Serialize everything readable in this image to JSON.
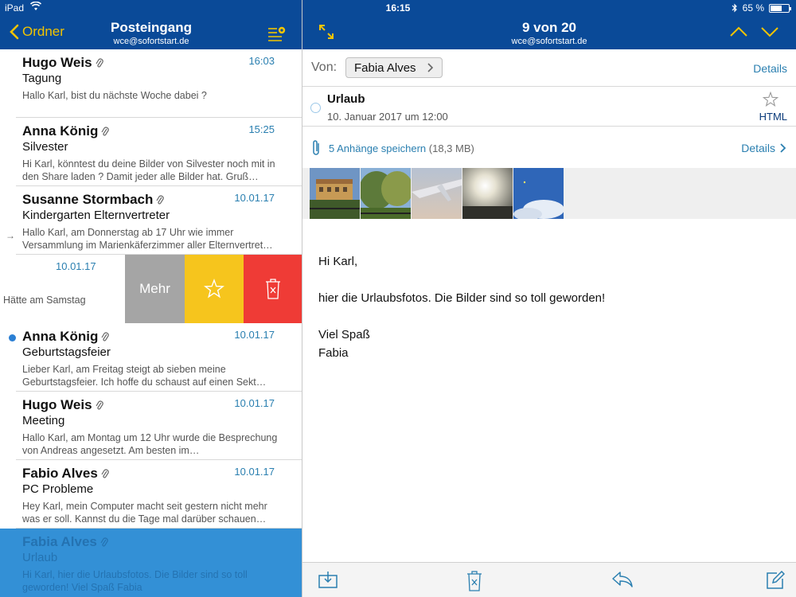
{
  "status": {
    "device": "iPad",
    "time": "16:15",
    "battery": "65 %",
    "battery_level": 0.65
  },
  "list_header": {
    "back_label": "Ordner",
    "title": "Posteingang",
    "account": "wce@sofortstart.de"
  },
  "detail_header": {
    "counter": "9 von 20",
    "account": "wce@sofortstart.de"
  },
  "mails": [
    {
      "sender": "Hugo Weis",
      "date": "16:03",
      "subject": "Tagung",
      "preview": "Hallo Karl, bist du nächste Woche dabei ?",
      "attachment": true
    },
    {
      "sender": "Anna König",
      "date": "15:25",
      "subject": "Silvester",
      "preview": "Hi Karl, könntest du deine Bilder von Silvester noch mit in den Share laden ? Damit jeder alle Bilder hat. Gruß…",
      "attachment": true
    },
    {
      "sender": "Susanne Stormbach",
      "date": "10.01.17",
      "subject": "Kindergarten Elternvertreter",
      "preview": "Hallo Karl, am Donnerstag ab 17 Uhr wie immer Versammlung im Marienkäferzimmer aller Elternvertret…",
      "attachment": true,
      "forwarded": true
    },
    {
      "date": "10.01.17",
      "preview": "Hätte am Samstag"
    },
    {
      "sender": "Anna König",
      "date": "10.01.17",
      "subject": "Geburtstagsfeier",
      "preview": "Lieber Karl, am Freitag steigt ab sieben meine Geburtstagsfeier. Ich hoffe du schaust auf einen Sekt…",
      "attachment": true,
      "unread": true
    },
    {
      "sender": "Hugo Weis",
      "date": "10.01.17",
      "subject": "Meeting",
      "preview": "Hallo Karl, am Montag um 12 Uhr wurde die Besprechung von Andreas angesetzt. Am besten im…",
      "attachment": true
    },
    {
      "sender": "Fabio Alves",
      "date": "10.01.17",
      "subject": "PC  Probleme",
      "preview": "Hey Karl, mein Computer macht seit gestern nicht mehr was er soll. Kannst du die Tage mal darüber schauen…",
      "attachment": true
    },
    {
      "sender": "Fabia Alves",
      "date": "",
      "subject": "Urlaub",
      "preview": "Hi Karl, hier die Urlaubsfotos. Die Bilder sind so toll geworden! Viel Spaß Fabia",
      "attachment": true,
      "selected": true
    }
  ],
  "swipe_actions": {
    "more": "Mehr"
  },
  "detail": {
    "from_label": "Von:",
    "from_name": "Fabia Alves",
    "details_label": "Details",
    "subject": "Urlaub",
    "date": "10. Januar 2017 um 12:00",
    "format": "HTML",
    "attachments_label": "5 Anhänge speichern",
    "attachments_size": "(18,3 MB)",
    "attachments_details": "Details",
    "body": [
      "Hi Karl,",
      "hier die Urlaubsfotos. Die Bilder sind so toll geworden!",
      "Viel Spaß",
      "Fabia"
    ]
  },
  "icons": {
    "back": "chevron-left-icon",
    "list_settings": "list-settings-icon",
    "expand": "expand-icon",
    "nav_up": "chevron-up-icon",
    "nav_down": "chevron-down-icon",
    "attachment": "paperclip-icon",
    "star": "star-icon",
    "trash": "trash-icon",
    "save": "save-to-folder-icon",
    "reply": "reply-icon",
    "compose": "compose-icon"
  },
  "colors": {
    "header": "#0a4a98",
    "accent_yellow": "#f2c400",
    "link_blue": "#2a7fb0",
    "selected_row": "#3390d6",
    "action_more": "#a5a5a5",
    "action_star": "#f6c51d",
    "action_delete": "#ef3b36"
  }
}
